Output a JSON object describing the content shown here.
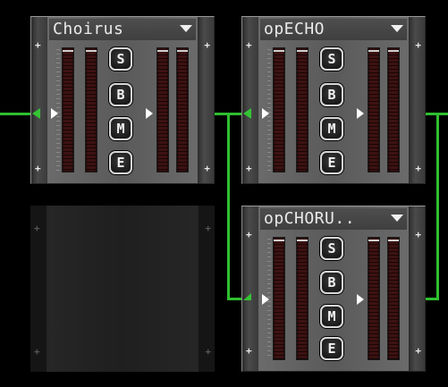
{
  "modules": [
    {
      "id": "choirus",
      "title": "Choirus",
      "buttons": [
        "S",
        "B",
        "M",
        "E"
      ]
    },
    {
      "id": "opecho",
      "title": "opECHO",
      "buttons": [
        "S",
        "B",
        "M",
        "E"
      ]
    },
    {
      "id": "opchorus",
      "title": "opCHORU..",
      "buttons": [
        "S",
        "B",
        "M",
        "E"
      ]
    }
  ],
  "empty_slot": {
    "plus_glyph": "+"
  },
  "icons": {
    "menu": "dropdown-arrow-icon",
    "solo": "solo-icon",
    "bypass": "bypass-icon",
    "mute": "mute-icon",
    "edit": "edit-icon"
  },
  "colors": {
    "wire": "#2fbf2f",
    "meter": "#3d1212",
    "panel": "#5a5a5a"
  }
}
